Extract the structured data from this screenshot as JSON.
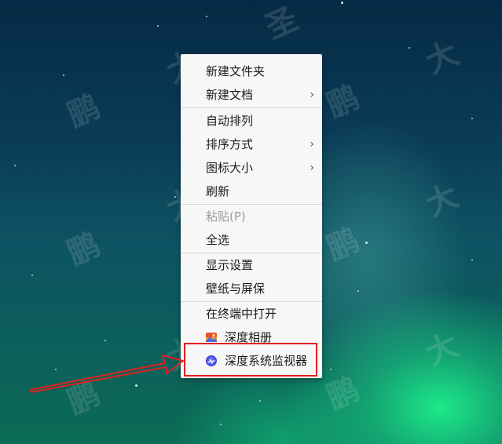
{
  "watermark_text": "鹏 大 圣",
  "context_menu": {
    "items": [
      {
        "label": "新建文件夹"
      },
      {
        "label": "新建文档",
        "submenu_arrow": "›"
      },
      {
        "label": "自动排列"
      },
      {
        "label": "排序方式",
        "submenu_arrow": "›"
      },
      {
        "label": "图标大小",
        "submenu_arrow": "›"
      },
      {
        "label": "刷新"
      },
      {
        "label": "粘贴(P)",
        "disabled": true
      },
      {
        "label": "全选"
      },
      {
        "label": "显示设置"
      },
      {
        "label": "壁纸与屏保"
      },
      {
        "label": "在终端中打开"
      },
      {
        "label": "深度相册",
        "icon": "photo-album-icon"
      },
      {
        "label": "深度系统监视器",
        "icon": "system-monitor-icon"
      }
    ]
  },
  "annotation": {
    "highlight_color": "#e02020",
    "target": "深度系统监视器"
  }
}
